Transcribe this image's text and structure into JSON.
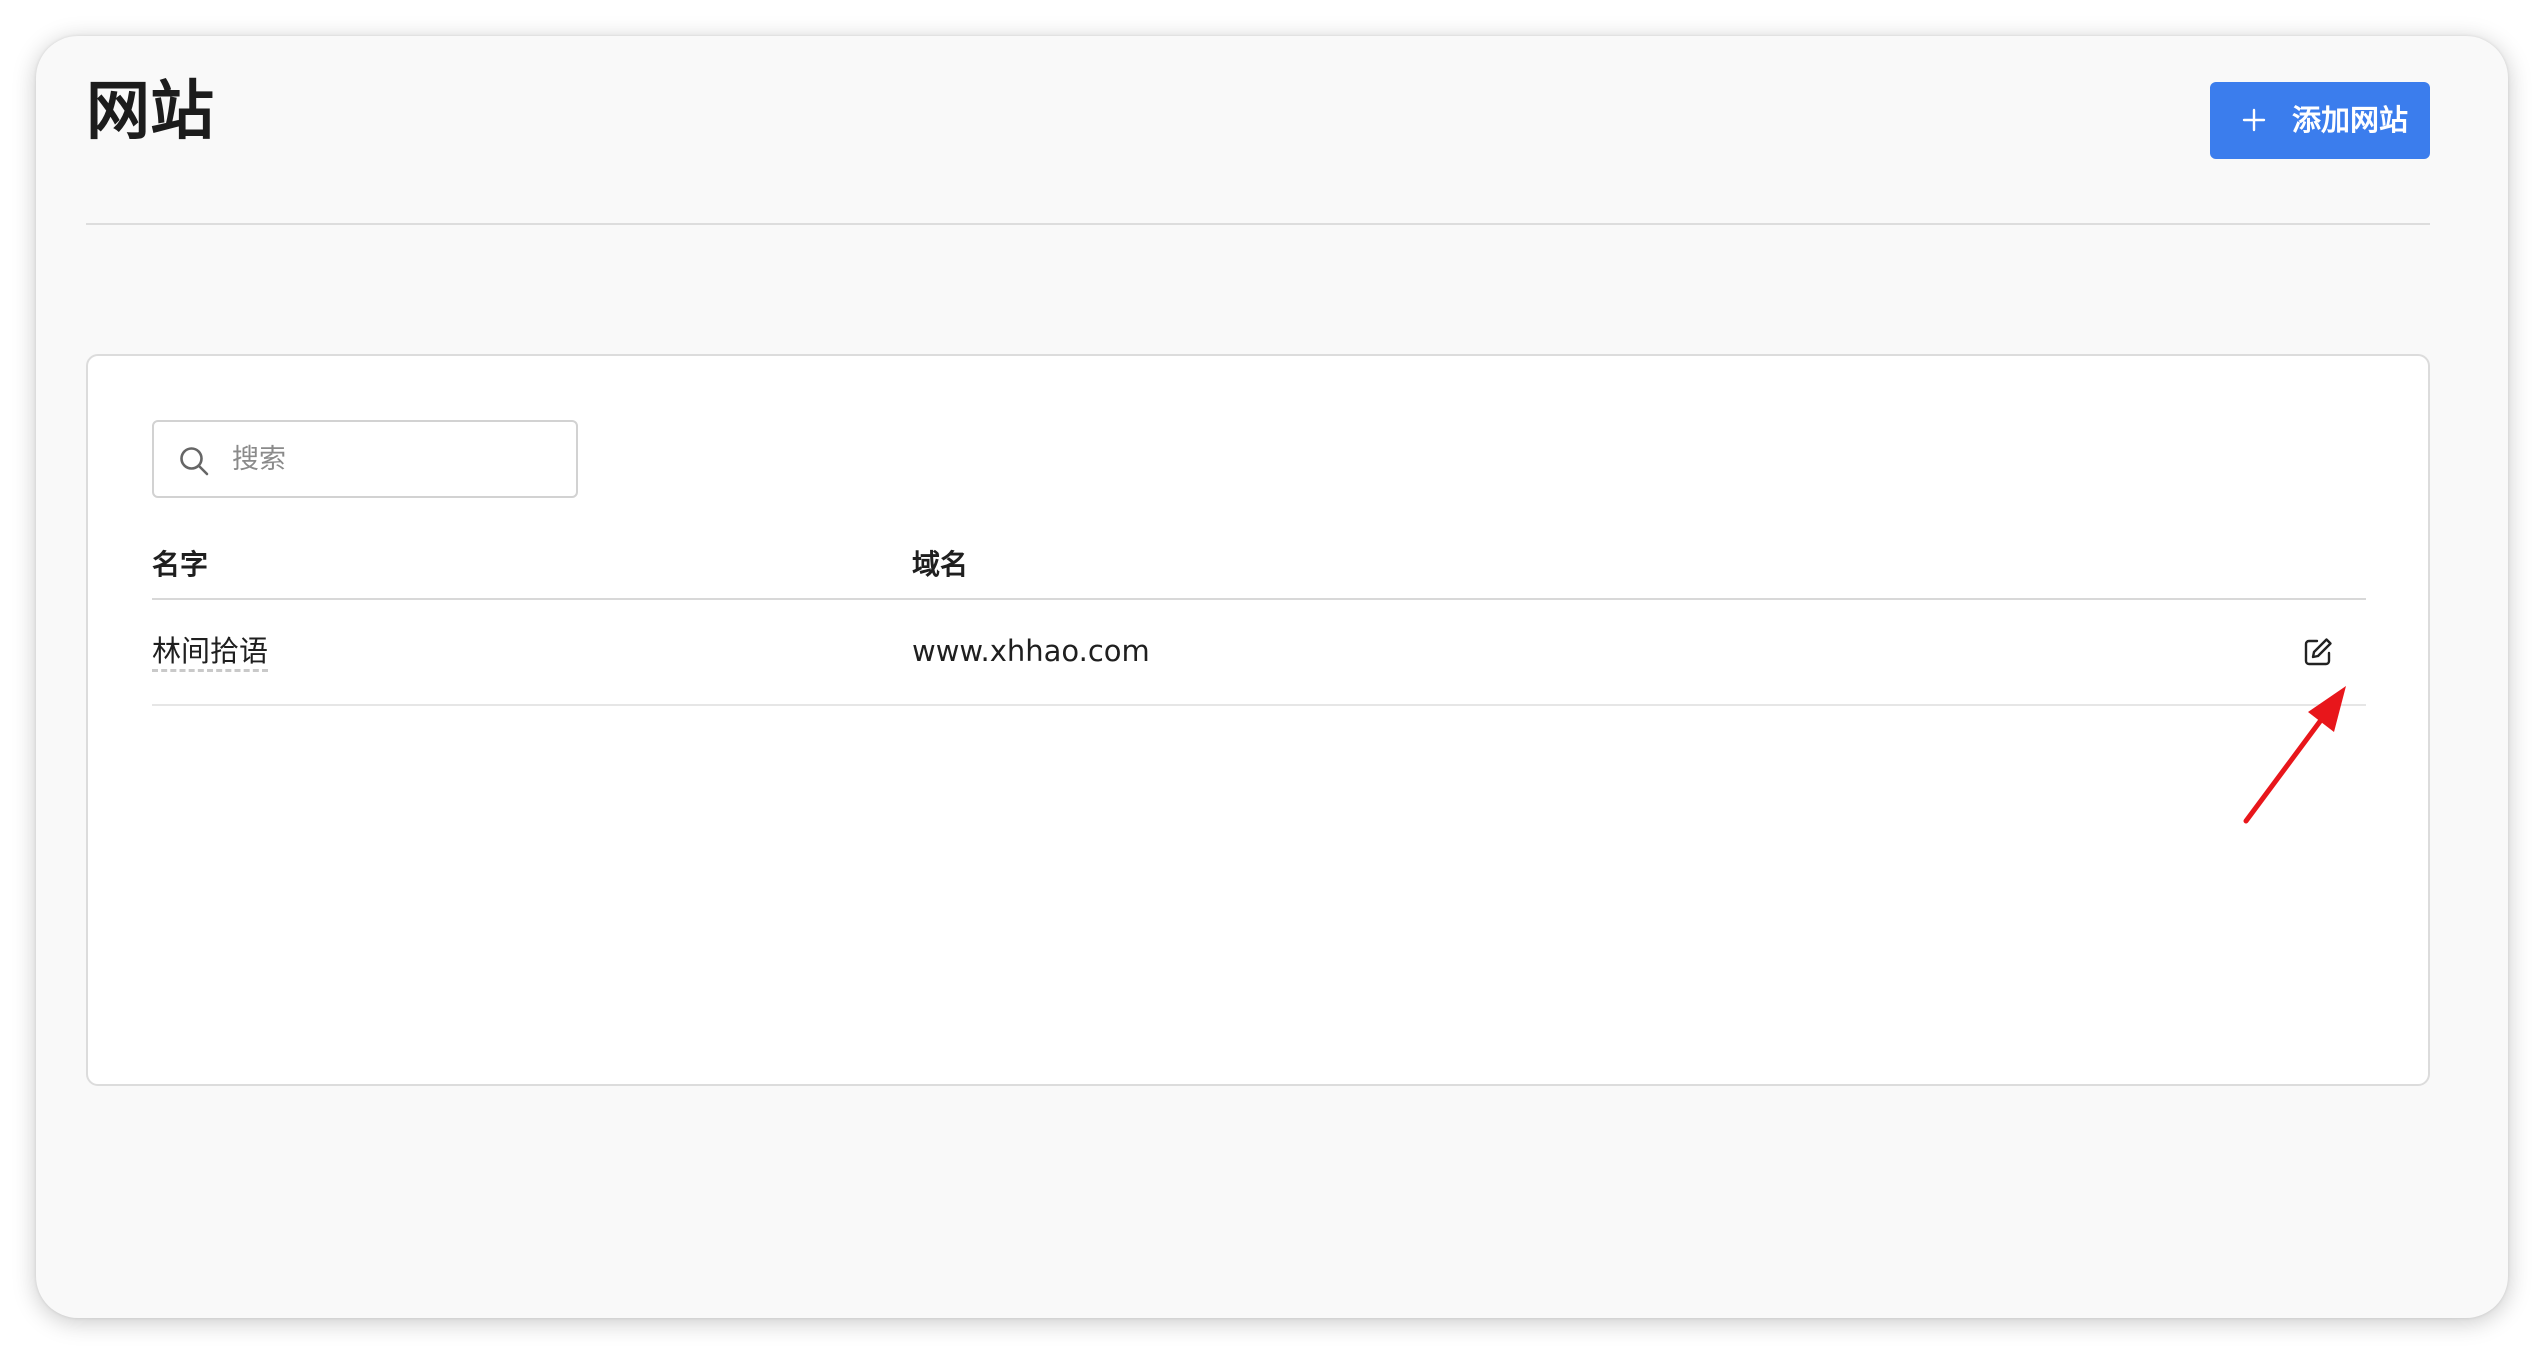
{
  "page": {
    "title": "网站"
  },
  "header": {
    "add_button_label": "添加网站",
    "add_icon": "plus-icon"
  },
  "search": {
    "placeholder": "搜索",
    "value": "",
    "icon": "search-icon"
  },
  "table": {
    "columns": [
      "名字",
      "域名"
    ],
    "rows": [
      {
        "name": "林间拾语",
        "domain": "www.xhhao.com",
        "action_icon": "edit-icon"
      }
    ]
  },
  "annotation": {
    "icon": "arrow-annotation",
    "color": "#e8161b"
  },
  "colors": {
    "accent": "#3b7ded",
    "background": "#f9f9f9",
    "card": "#ffffff"
  }
}
